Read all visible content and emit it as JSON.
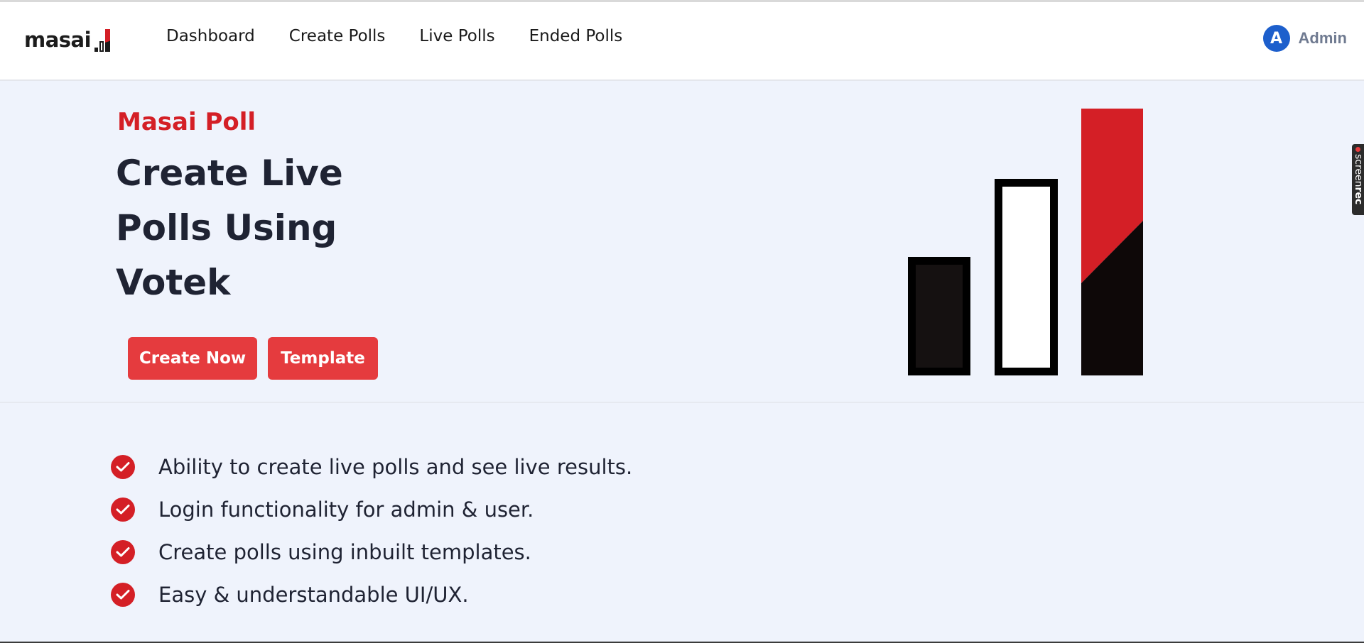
{
  "navbar": {
    "logo_text": "masai",
    "links": [
      "Dashboard",
      "Create Polls",
      "Live Polls",
      "Ended Polls"
    ],
    "user": {
      "avatar_letter": "A",
      "name": "Admin"
    }
  },
  "hero": {
    "eyebrow": "Masai Poll",
    "headline_lines": [
      "Create Live",
      "Polls Using",
      "Votek"
    ],
    "buttons": {
      "create": "Create Now",
      "template": "Template"
    }
  },
  "features": [
    "Ability to create live polls and see live results.",
    "Login functionality for admin & user.",
    "Create polls using inbuilt templates.",
    "Easy & understandable UI/UX."
  ],
  "overlay": {
    "recorder_label_light": "screen",
    "recorder_label_bold": "rec"
  },
  "colors": {
    "brand_red": "#d41f26",
    "button_red": "#e53b3e",
    "hero_bg": "#eff3fc",
    "avatar_blue": "#1d5fcc",
    "text_dark": "#1f2333"
  },
  "icons": {
    "feature_bullet": "check-circle-icon",
    "logo_mark": "bar-chart-icon"
  }
}
